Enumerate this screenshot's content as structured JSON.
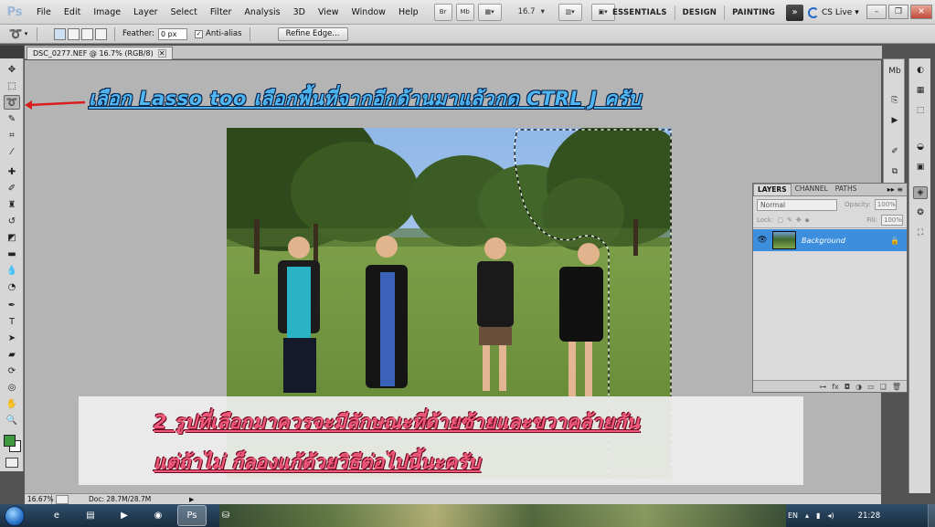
{
  "app": {
    "logo": "Ps"
  },
  "menu": [
    "File",
    "Edit",
    "Image",
    "Layer",
    "Select",
    "Filter",
    "Analysis",
    "3D",
    "View",
    "Window",
    "Help"
  ],
  "menubar_buttons": {
    "bridge": "Br",
    "mini_bridge": "Mb",
    "zoom": "16.7",
    "zoom_arrow": "▾"
  },
  "workspaces": [
    "ESSENTIALS",
    "DESIGN",
    "PAINTING"
  ],
  "workspace_more": "»",
  "cs_live": "CS Live",
  "cs_live_arrow": "▾",
  "window_controls": {
    "minimize": "–",
    "restore": "❐",
    "close": "✕"
  },
  "options": {
    "tool_icon": "lasso-icon",
    "feather_label": "Feather:",
    "feather_value": "0 px",
    "antialias_label": "Anti-alias",
    "antialias_checked": true,
    "refine_label": "Refine Edge..."
  },
  "document": {
    "tab_title": "DSC_0277.NEF @ 16.7% (RGB/8)",
    "tab_close": "✕"
  },
  "annotations": {
    "line1": "เลือก Lasso too เลือกพื้นที่จากอีกด้านมาแล้วกด  CTRL J ครับ",
    "line2": "2 รูปที่เลือกมาควรจะมีลักษณะที่ด้ายซ้ายและขวาคล้ายกัน",
    "line3": "แต่ถ้าไม่ ก็ลองแก้ด้วยวิธีต่อไปนี้นะครับ"
  },
  "status": {
    "zoom": "16.67%",
    "doc_size": "Doc: 28.7M/28.7M",
    "arrow": "▶"
  },
  "layers_panel": {
    "tabs": [
      "LAYERS",
      "CHANNEL",
      "PATHS"
    ],
    "menu": "▸▸ ≡",
    "blend_mode": "Normal",
    "opacity_label": "Opacity:",
    "opacity": "100%",
    "lock_label": "Lock:",
    "fill_label": "Fill:",
    "fill": "100%",
    "layer_name": "Background",
    "layer_lock": "🔒",
    "eye": "👁",
    "footer_icons": [
      "⊶",
      "fx",
      "◘",
      "◑",
      "▭",
      "❑",
      "🗑"
    ]
  },
  "taskbar": {
    "language": "EN",
    "clock": "21:28",
    "apps": [
      "ie-icon",
      "explorer-icon",
      "media-icon",
      "chrome-icon",
      "photoshop-icon",
      "network-icon"
    ],
    "app_glyphs": [
      "e",
      "▤",
      "▶",
      "◉",
      "Ps",
      "⛁"
    ],
    "tray_glyphs": [
      "▴",
      "▮",
      "◂)"
    ]
  },
  "colors": {
    "foreground": "#3f9a3f",
    "background": "#ffffff",
    "layer_selected": "#3d8fde",
    "annot_blue": "#4fb6f2",
    "annot_pink": "#f05a7a"
  }
}
